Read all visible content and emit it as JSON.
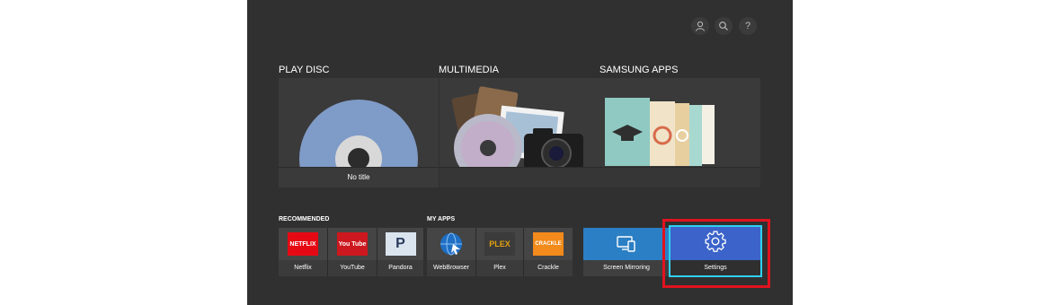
{
  "header": {
    "icons": [
      "user-icon",
      "search-icon",
      "help-icon"
    ],
    "help_glyph": "?"
  },
  "sections": {
    "play_disc": {
      "title": "PLAY DISC",
      "caption": "No title"
    },
    "multimedia": {
      "title": "MULTIMEDIA"
    },
    "samsung_apps": {
      "title": "SAMSUNG APPS"
    }
  },
  "recommended": {
    "title": "RECOMMENDED",
    "items": [
      {
        "label": "Netflix",
        "logo_text": "NETFLIX",
        "color": "#e50914"
      },
      {
        "label": "YouTube",
        "logo_text": "You Tube",
        "color": "#cc181e"
      },
      {
        "label": "Pandora",
        "logo_text": "P",
        "color": "#d9e4ee"
      }
    ]
  },
  "my_apps": {
    "title": "MY APPS",
    "items": [
      {
        "label": "WebBrowser",
        "icon": "globe-icon"
      },
      {
        "label": "Plex",
        "logo_text": "PLEX",
        "color": "#3b3b3b"
      },
      {
        "label": "Crackle",
        "logo_text": "CRACKLE",
        "color": "#f28a1c"
      }
    ]
  },
  "quick": {
    "screen_mirroring": {
      "label": "Screen Mirroring",
      "color": "#2b7fc4"
    },
    "settings": {
      "label": "Settings",
      "color": "#3b63c9"
    }
  },
  "highlight_color": "#e0131f"
}
